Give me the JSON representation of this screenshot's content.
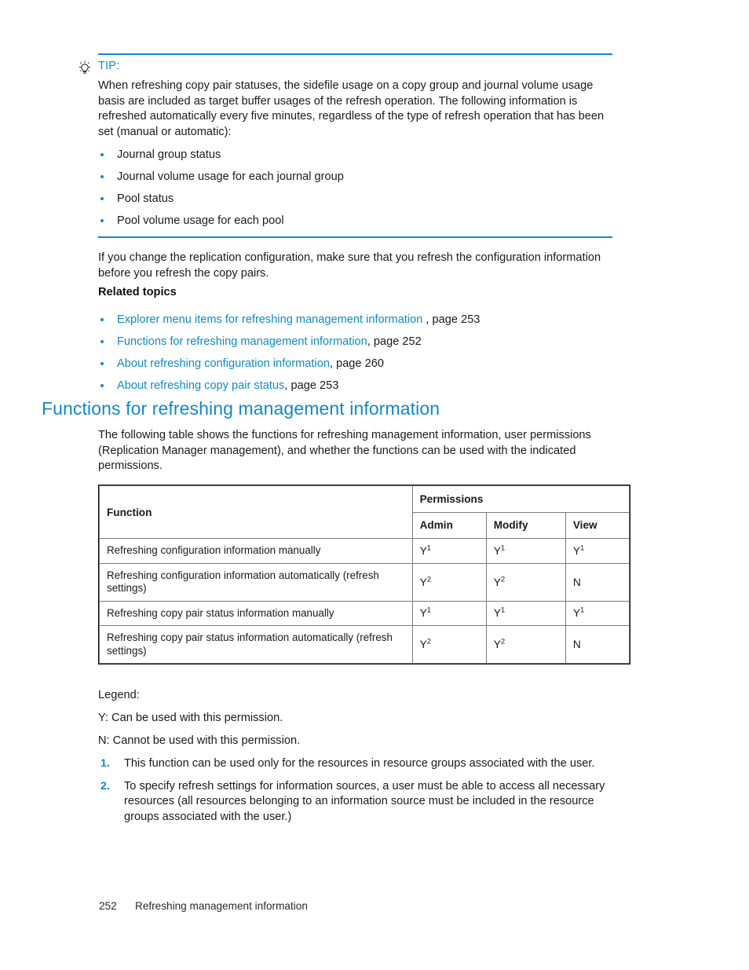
{
  "tip": {
    "icon": "lightbulb-icon",
    "label": "TIP:",
    "body": "When refreshing copy pair statuses, the sidefile usage on a copy group and journal volume usage basis are included as target buffer usages of the refresh operation. The following information is refreshed automatically every five minutes, regardless of the type of refresh operation that has been set (manual or automatic):",
    "items": [
      "Journal group status",
      "Journal volume usage for each journal group",
      "Pool status",
      "Pool volume usage for each pool"
    ]
  },
  "intro_paragraph": "If you change the replication configuration, make sure that you refresh the configuration information before you refresh the copy pairs.",
  "related": {
    "heading": "Related topics",
    "items": [
      {
        "link": "Explorer menu items for refreshing management information",
        "page": " , page 253"
      },
      {
        "link": "Functions for refreshing management information",
        "page": ", page 252"
      },
      {
        "link": "About refreshing configuration information",
        "page": ", page 260"
      },
      {
        "link": "About refreshing copy pair status",
        "page": ", page 253"
      }
    ]
  },
  "section": {
    "heading": "Functions for refreshing management information",
    "paragraph": "The following table shows the functions for refreshing management information, user permissions (Replication Manager management), and whether the functions can be used with the indicated permissions."
  },
  "table": {
    "col_function": "Function",
    "group_header": "Permissions",
    "sub_headers": [
      "Admin",
      "Modify",
      "View"
    ],
    "rows": [
      {
        "function": "Refreshing configuration information manually",
        "admin": "Y",
        "admin_sup": "1",
        "modify": "Y",
        "modify_sup": "1",
        "view": "Y",
        "view_sup": "1"
      },
      {
        "function": "Refreshing configuration information automatically (refresh settings)",
        "admin": "Y",
        "admin_sup": "2",
        "modify": "Y",
        "modify_sup": "2",
        "view": "N",
        "view_sup": ""
      },
      {
        "function": "Refreshing copy pair status information manually",
        "admin": "Y",
        "admin_sup": "1",
        "modify": "Y",
        "modify_sup": "1",
        "view": "Y",
        "view_sup": "1"
      },
      {
        "function": "Refreshing copy pair status information automatically (refresh settings)",
        "admin": "Y",
        "admin_sup": "2",
        "modify": "Y",
        "modify_sup": "2",
        "view": "N",
        "view_sup": ""
      }
    ]
  },
  "legend": {
    "title": "Legend:",
    "y_line": "Y: Can be used with this permission.",
    "n_line": "N: Cannot be used with this permission.",
    "notes": [
      {
        "num": "1.",
        "text": "This function can be used only for the resources in resource groups associated with the user."
      },
      {
        "num": "2.",
        "text": "To specify refresh settings for information sources, a user must be able to access all necessary resources (all resources belonging to an information source must be included in the resource groups associated with the user.)"
      }
    ]
  },
  "footer": {
    "page_number": "252",
    "chapter": "Refreshing management information"
  },
  "colors": {
    "accent_blue": "#1289c4",
    "text": "#1a1a1a",
    "rule": "#1289c4",
    "table_border": "#000000",
    "table_inner": "#7b7b7b"
  }
}
